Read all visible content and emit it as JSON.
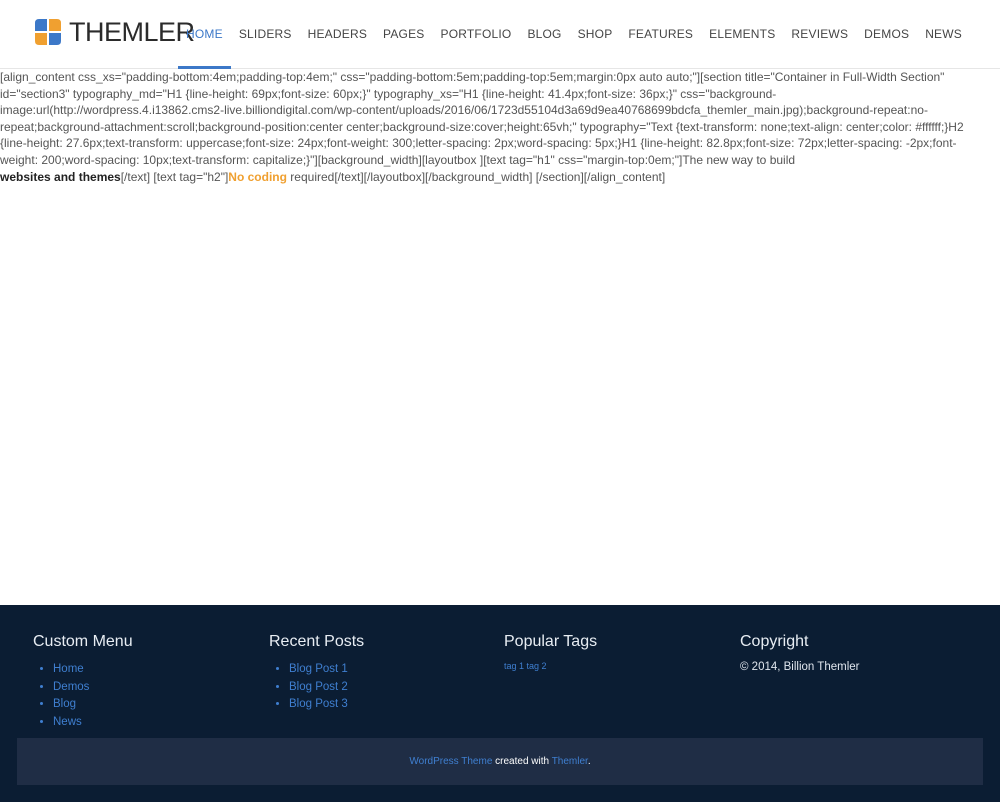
{
  "header": {
    "logo_text": "THEMLER",
    "nav": [
      {
        "label": "HOME",
        "active": true
      },
      {
        "label": "SLIDERS"
      },
      {
        "label": "HEADERS"
      },
      {
        "label": "PAGES"
      },
      {
        "label": "PORTFOLIO"
      },
      {
        "label": "BLOG"
      },
      {
        "label": "SHOP"
      },
      {
        "label": "FEATURES"
      },
      {
        "label": "ELEMENTS"
      },
      {
        "label": "REVIEWS"
      },
      {
        "label": "DEMOS"
      },
      {
        "label": "NEWS"
      }
    ]
  },
  "content": {
    "raw_text": "[align_content css_xs=\"padding-bottom:4em;padding-top:4em;\" css=\"padding-bottom:5em;padding-top:5em;margin:0px auto auto;\"][section title=\"Container in Full-Width Section\" id=\"section3\" typography_md=\"H1 {line-height: 69px;font-size: 60px;}\" typography_xs=\"H1 {line-height: 41.4px;font-size: 36px;}\" css=\"background-image:url(http://wordpress.4.i13862.cms2-live.billiondigital.com/wp-content/uploads/2016/06/1723d55104d3a69d9ea40768699bdcfa_themler_main.jpg);background-repeat:no-repeat;background-attachment:scroll;background-position:center center;background-size:cover;height:65vh;\" typography=\"Text {text-transform: none;text-align: center;color: #ffffff;}H2 {line-height: 27.6px;text-transform: uppercase;font-size: 24px;font-weight: 300;letter-spacing: 2px;word-spacing: 5px;}H1 {line-height: 82.8px;font-size: 72px;letter-spacing: -2px;font-weight: 200;word-spacing: 10px;text-transform: capitalize;}\"][background_width][layoutbox ][text tag=\"h1\" css=\"margin-top:0em;\"]The new way to build",
    "bold_text": "websites and themes",
    "after_bold": "[/text] [text tag=\"h2\"]",
    "accent_text": "No coding",
    "tail_text": " required[/text][/layoutbox][/background_width] [/section][/align_content]"
  },
  "footer": {
    "custom_menu": {
      "title": "Custom Menu",
      "items": [
        "Home",
        "Demos",
        "Blog",
        "News"
      ]
    },
    "recent_posts": {
      "title": "Recent Posts",
      "items": [
        "Blog Post 1",
        "Blog Post 2",
        "Blog Post 3"
      ]
    },
    "popular_tags": {
      "title": "Popular Tags",
      "tags": "tag 1 tag 2"
    },
    "copyright": {
      "title": "Copyright",
      "text": "© 2014, Billion Themler"
    },
    "bar": {
      "link1": "WordPress Theme",
      "middle": " created with ",
      "link2": "Themler",
      "end": "."
    }
  },
  "colors": {
    "accent_blue": "#3c78c8",
    "accent_orange": "#f0a030",
    "footer_bg": "#0b1d33",
    "footer_bar_bg": "#1f2d45"
  }
}
